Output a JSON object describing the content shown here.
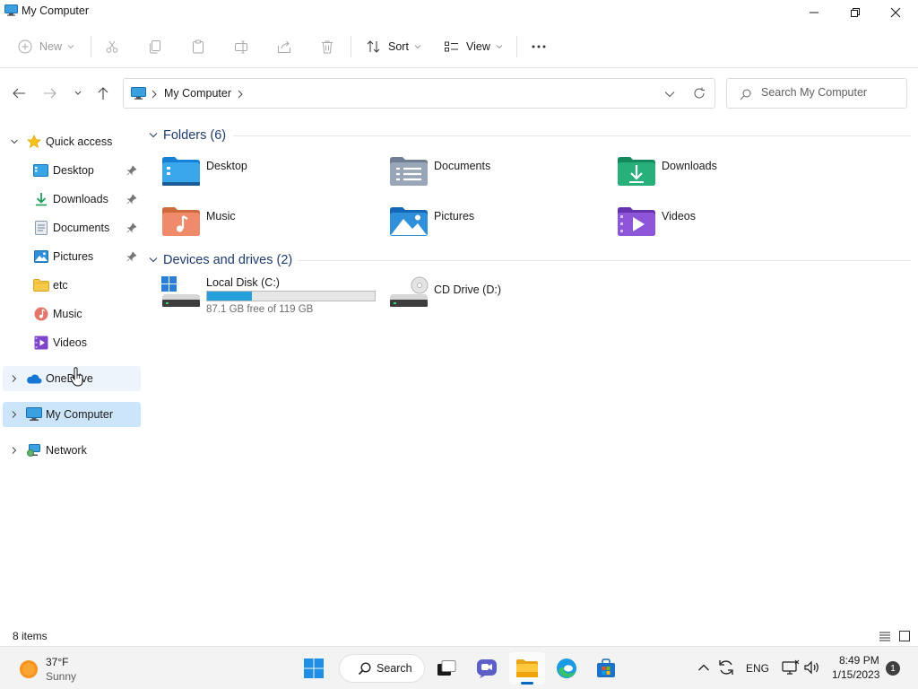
{
  "window": {
    "title": "My Computer"
  },
  "toolbar": {
    "new_label": "New",
    "sort_label": "Sort",
    "view_label": "View"
  },
  "address": {
    "breadcrumb": [
      "My Computer"
    ],
    "search_placeholder": "Search My Computer"
  },
  "sidebar": {
    "quick_access": "Quick access",
    "items": [
      {
        "label": "Desktop",
        "icon": "desktop-icon",
        "pinned": true
      },
      {
        "label": "Downloads",
        "icon": "downloads-icon",
        "pinned": true
      },
      {
        "label": "Documents",
        "icon": "documents-icon",
        "pinned": true
      },
      {
        "label": "Pictures",
        "icon": "pictures-icon",
        "pinned": true
      },
      {
        "label": "etc",
        "icon": "folder-icon",
        "pinned": false
      },
      {
        "label": "Music",
        "icon": "music-icon",
        "pinned": false
      },
      {
        "label": "Videos",
        "icon": "videos-icon",
        "pinned": false
      }
    ],
    "onedrive": "OneDrive",
    "this_pc": "My Computer",
    "network": "Network"
  },
  "content": {
    "folders_header": "Folders (6)",
    "folders": [
      {
        "label": "Desktop",
        "icon": "desktop-folder-icon"
      },
      {
        "label": "Documents",
        "icon": "documents-folder-icon"
      },
      {
        "label": "Downloads",
        "icon": "downloads-folder-icon"
      },
      {
        "label": "Music",
        "icon": "music-folder-icon"
      },
      {
        "label": "Pictures",
        "icon": "pictures-folder-icon"
      },
      {
        "label": "Videos",
        "icon": "videos-folder-icon"
      }
    ],
    "drives_header": "Devices and drives (2)",
    "drives": [
      {
        "label": "Local Disk (C:)",
        "free_text": "87.1 GB free of 119 GB",
        "used_fraction": 0.268
      },
      {
        "label": "CD Drive (D:)"
      }
    ]
  },
  "status": {
    "item_count": "8 items"
  },
  "taskbar": {
    "weather_temp": "37°F",
    "weather_desc": "Sunny",
    "search_label": "Search",
    "language": "ENG",
    "time": "8:49 PM",
    "date": "1/15/2023",
    "notification_count": "1"
  },
  "colors": {
    "accent": "#0067c0",
    "selected": "#cde5fa",
    "drive_bar": "#26a0da",
    "group_header": "#1e3b70"
  }
}
